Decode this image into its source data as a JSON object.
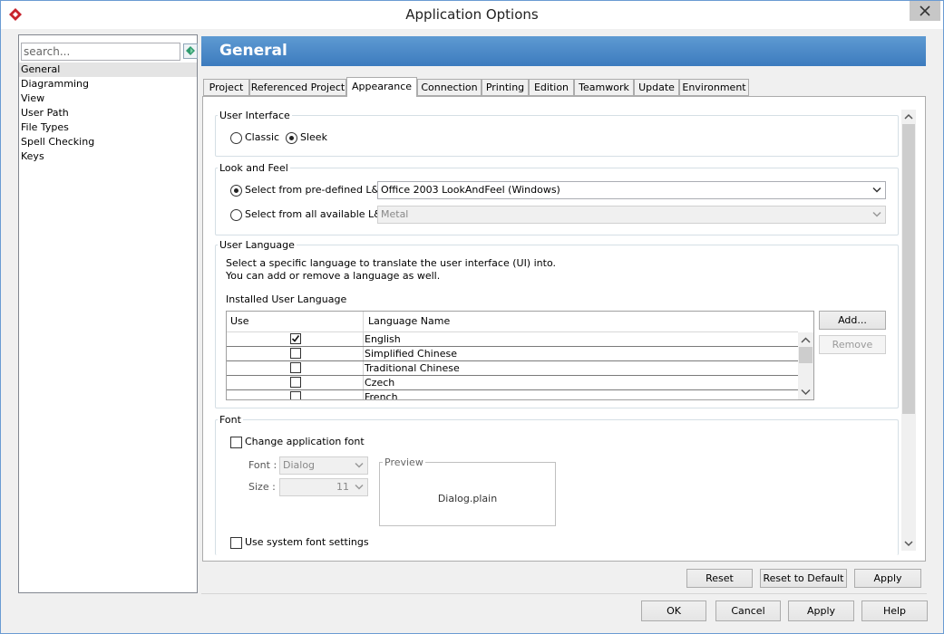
{
  "window": {
    "title": "Application Options",
    "close_icon": "close-icon",
    "accent_color": "#3c7bbe"
  },
  "sidebar": {
    "search_placeholder": "search...",
    "items": [
      {
        "label": "General",
        "selected": true
      },
      {
        "label": "Diagramming"
      },
      {
        "label": "View"
      },
      {
        "label": "User Path"
      },
      {
        "label": "File Types"
      },
      {
        "label": "Spell Checking"
      },
      {
        "label": "Keys"
      }
    ]
  },
  "header": {
    "title": "General"
  },
  "tabs": [
    {
      "label": "Project"
    },
    {
      "label": "Referenced Project"
    },
    {
      "label": "Appearance",
      "active": true
    },
    {
      "label": "Connection"
    },
    {
      "label": "Printing"
    },
    {
      "label": "Edition"
    },
    {
      "label": "Teamwork"
    },
    {
      "label": "Update"
    },
    {
      "label": "Environment"
    }
  ],
  "user_interface": {
    "title": "User Interface",
    "classic_label": "Classic",
    "sleek_label": "Sleek",
    "selected": "Sleek"
  },
  "look_and_feel": {
    "title": "Look and Feel",
    "predefined_label": "Select from pre-defined L&F:",
    "predefined_value": "Office 2003 LookAndFeel (Windows)",
    "available_label": "Select from all available L&F:",
    "available_value": "Metal",
    "selected": "predefined"
  },
  "user_language": {
    "title": "User Language",
    "description_line1": "Select a specific language to translate the user interface (UI) into.",
    "description_line2": "You can add or remove a language as well.",
    "installed_label": "Installed User Language",
    "col_use": "Use",
    "col_name": "Language Name",
    "rows": [
      {
        "name": "English",
        "checked": true
      },
      {
        "name": "Simplified Chinese",
        "checked": false
      },
      {
        "name": "Traditional Chinese",
        "checked": false
      },
      {
        "name": "Czech",
        "checked": false
      },
      {
        "name": "French",
        "checked": false
      }
    ],
    "add_label": "Add...",
    "remove_label": "Remove"
  },
  "font": {
    "title": "Font",
    "change_label": "Change application font",
    "font_label": "Font :",
    "font_value": "Dialog",
    "size_label": "Size :",
    "size_value": "11",
    "preview_title": "Preview",
    "preview_text": "Dialog.plain",
    "system_label": "Use system font settings"
  },
  "panel_buttons": {
    "reset": "Reset",
    "reset_default": "Reset to Default",
    "apply": "Apply"
  },
  "dialog_buttons": {
    "ok": "OK",
    "cancel": "Cancel",
    "apply": "Apply",
    "help": "Help"
  }
}
